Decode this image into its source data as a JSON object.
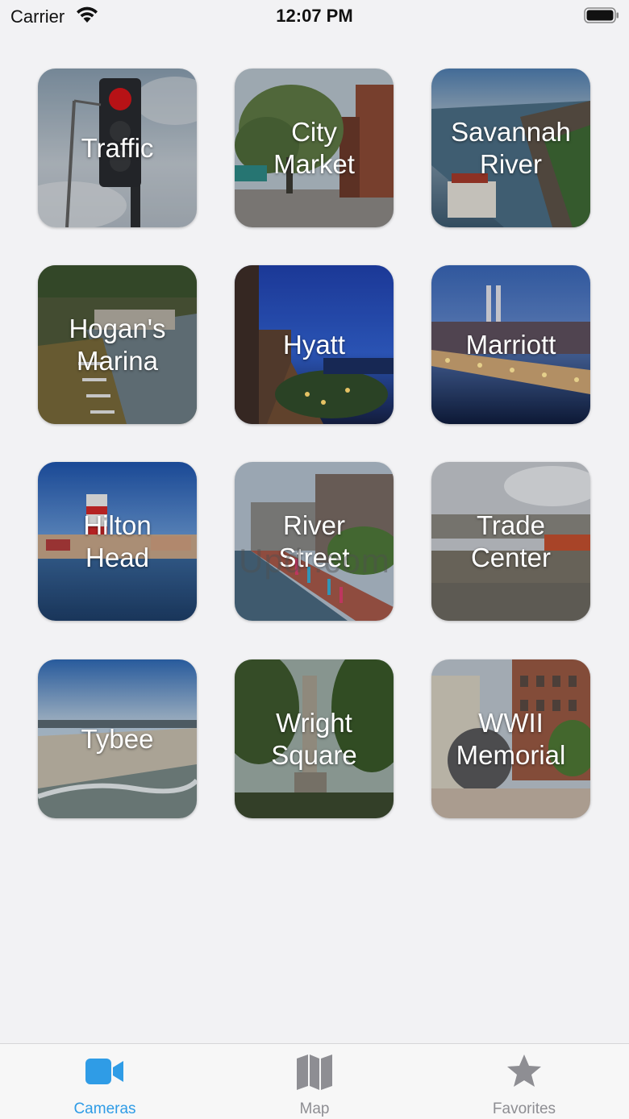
{
  "status_bar": {
    "carrier": "Carrier",
    "time": "12:07 PM"
  },
  "tiles": [
    {
      "label": "Traffic"
    },
    {
      "label": "City\nMarket"
    },
    {
      "label": "Savannah\nRiver"
    },
    {
      "label": "Hogan's\nMarina"
    },
    {
      "label": "Hyatt"
    },
    {
      "label": "Marriott"
    },
    {
      "label": "Hilton\nHead"
    },
    {
      "label": "River\nStreet"
    },
    {
      "label": "Trade\nCenter"
    },
    {
      "label": "Tybee"
    },
    {
      "label": "Wright\nSquare"
    },
    {
      "label": "WWII\nMemorial"
    }
  ],
  "watermark": "Upd          .com",
  "tab_bar": {
    "items": [
      {
        "label": "Cameras",
        "icon": "video-camera-icon",
        "selected": true
      },
      {
        "label": "Map",
        "icon": "map-icon",
        "selected": false
      },
      {
        "label": "Favorites",
        "icon": "star-icon",
        "selected": false
      }
    ]
  },
  "colors": {
    "accent": "#2f9ce6",
    "inactive": "#8e8e93",
    "background": "#f2f2f4"
  }
}
